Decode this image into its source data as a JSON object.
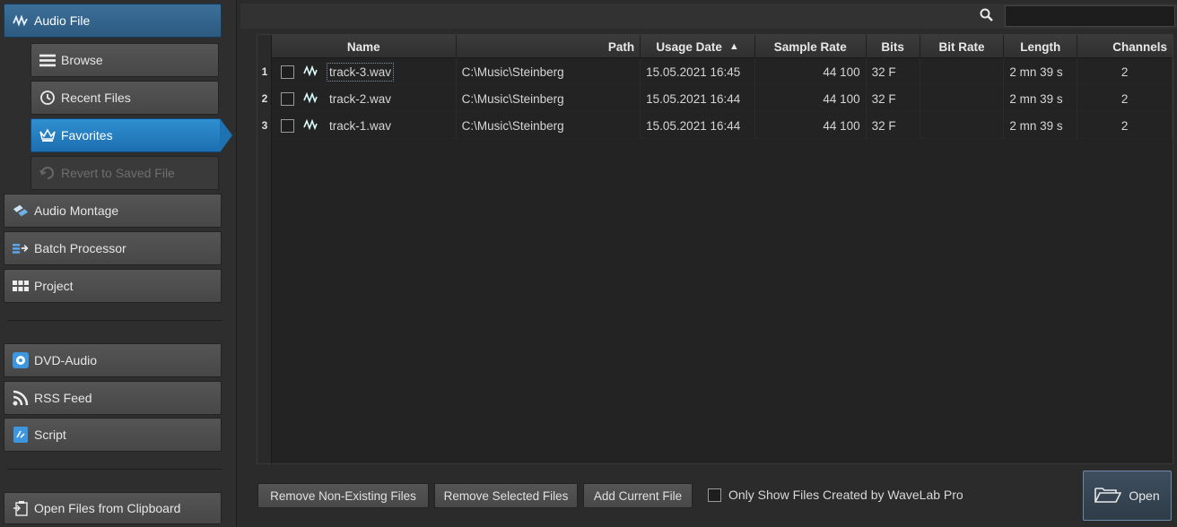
{
  "sidebar": {
    "audio_file": "Audio File",
    "browse": "Browse",
    "recent_files": "Recent Files",
    "favorites": "Favorites",
    "revert": "Revert to Saved File",
    "audio_montage": "Audio Montage",
    "batch_processor": "Batch Processor",
    "project": "Project",
    "dvd_audio": "DVD-Audio",
    "rss_feed": "RSS Feed",
    "script": "Script",
    "open_clipboard": "Open Files from Clipboard"
  },
  "search": {
    "value": ""
  },
  "table": {
    "headers": {
      "name": "Name",
      "path": "Path",
      "usage_date": "Usage Date",
      "sort_indicator": "▲",
      "sample_rate": "Sample Rate",
      "bits": "Bits",
      "bit_rate": "Bit Rate",
      "length": "Length",
      "channels": "Channels"
    },
    "rows": [
      {
        "num": "1",
        "name": "track-3.wav",
        "path": "C:\\Music\\Steinberg",
        "date": "15.05.2021 16:45",
        "sample_rate": "44 100",
        "bits": "32 F",
        "bit_rate": "",
        "length": "2 mn 39 s",
        "channels": "2"
      },
      {
        "num": "2",
        "name": "track-2.wav",
        "path": "C:\\Music\\Steinberg",
        "date": "15.05.2021 16:44",
        "sample_rate": "44 100",
        "bits": "32 F",
        "bit_rate": "",
        "length": "2 mn 39 s",
        "channels": "2"
      },
      {
        "num": "3",
        "name": "track-1.wav",
        "path": "C:\\Music\\Steinberg",
        "date": "15.05.2021 16:44",
        "sample_rate": "44 100",
        "bits": "32 F",
        "bit_rate": "",
        "length": "2 mn 39 s",
        "channels": "2"
      }
    ]
  },
  "bottom": {
    "remove_nonexisting": "Remove Non-Existing Files",
    "remove_selected": "Remove Selected Files",
    "add_current": "Add Current File",
    "only_show": "Only Show Files Created by WaveLab Pro",
    "open": "Open"
  },
  "colors": {
    "accent": "#1f72b2",
    "header_blue": "#2d5a80",
    "bg": "#2b2b2b"
  }
}
